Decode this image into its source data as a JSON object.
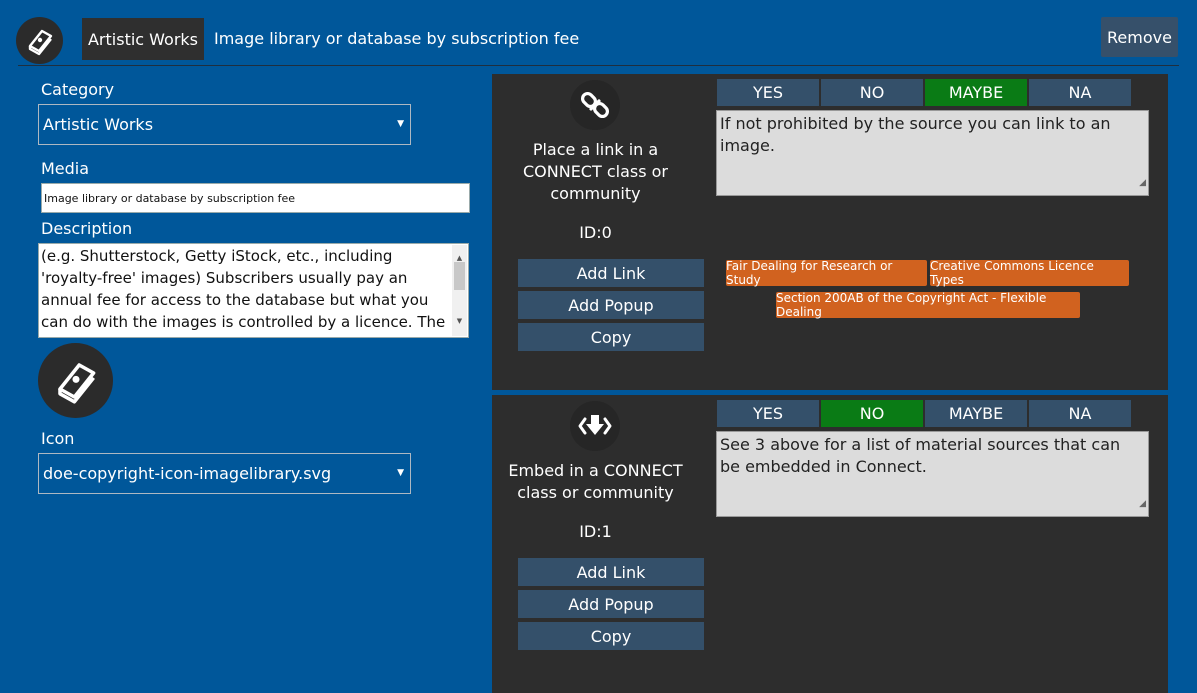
{
  "header": {
    "icon": "book-icon",
    "chip_label": "Artistic Works",
    "title": "Image library or database by subscription fee",
    "remove_label": "Remove"
  },
  "form": {
    "category_label": "Category",
    "category_value": "Artistic Works",
    "media_label": "Media",
    "media_value": "Image library or database by subscription fee",
    "description_label": "Description",
    "description_value": "(e.g. Shutterstock, Getty iStock, etc., including 'royalty-free' images) Subscribers usually pay an annual fee for access to the database but what you can do with the images is controlled by a licence. The licence usually",
    "icon_label": "Icon",
    "icon_value": "doe-copyright-icon-imagelibrary.svg"
  },
  "options": [
    "YES",
    "NO",
    "MAYBE",
    "NA"
  ],
  "panels": [
    {
      "icon": "link-icon",
      "title": "Place a link in a CONNECT class or community",
      "id_text": "ID:0",
      "selected": "MAYBE",
      "comment": "If not prohibited by the source you can link to an image.",
      "tags": [
        "Fair Dealing for Research or Study",
        "Creative Commons Licence Types",
        "Section 200AB of the Copyright Act - Flexible Dealing"
      ],
      "buttons": [
        "Add Link",
        "Add Popup",
        "Copy"
      ]
    },
    {
      "icon": "embed-icon",
      "title": "Embed in a CONNECT class or community",
      "id_text": "ID:1",
      "selected": "NO",
      "comment": "See 3 above for a list of material sources that can be embedded in Connect.",
      "tags": [],
      "buttons": [
        "Add Link",
        "Add Popup",
        "Copy"
      ]
    }
  ],
  "colors": {
    "background": "#00579a",
    "panel": "#2d2d2d",
    "button": "#34506a",
    "selected": "#0a7b15",
    "tag": "#d1621f"
  }
}
